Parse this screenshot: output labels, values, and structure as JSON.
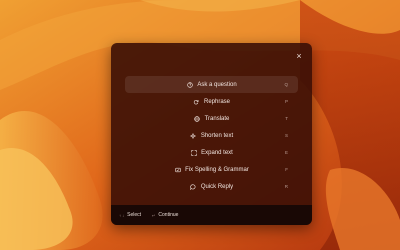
{
  "panel": {
    "close_icon": "×",
    "items": [
      {
        "label": "Ask a question",
        "shortcut": "Q",
        "icon": "question-circle-icon",
        "active": true
      },
      {
        "label": "Rephrase",
        "shortcut": "P",
        "icon": "refresh-icon"
      },
      {
        "label": "Translate",
        "shortcut": "T",
        "icon": "globe-icon"
      },
      {
        "label": "Shorten text",
        "shortcut": "S",
        "icon": "shrink-icon"
      },
      {
        "label": "Expand text",
        "shortcut": "E",
        "icon": "expand-icon"
      },
      {
        "label": "Fix Spelling & Grammar",
        "shortcut": "F",
        "icon": "spellcheck-icon"
      },
      {
        "label": "Quick Reply",
        "shortcut": "R",
        "icon": "reply-icon"
      }
    ]
  },
  "footer": {
    "select_keys": "↑ ↓",
    "select_label": "Select",
    "continue_key": "↵",
    "continue_label": "Continue"
  },
  "colors": {
    "wallpaper": "#d65a14",
    "panel": "#3a0e06",
    "footer": "#160805"
  }
}
